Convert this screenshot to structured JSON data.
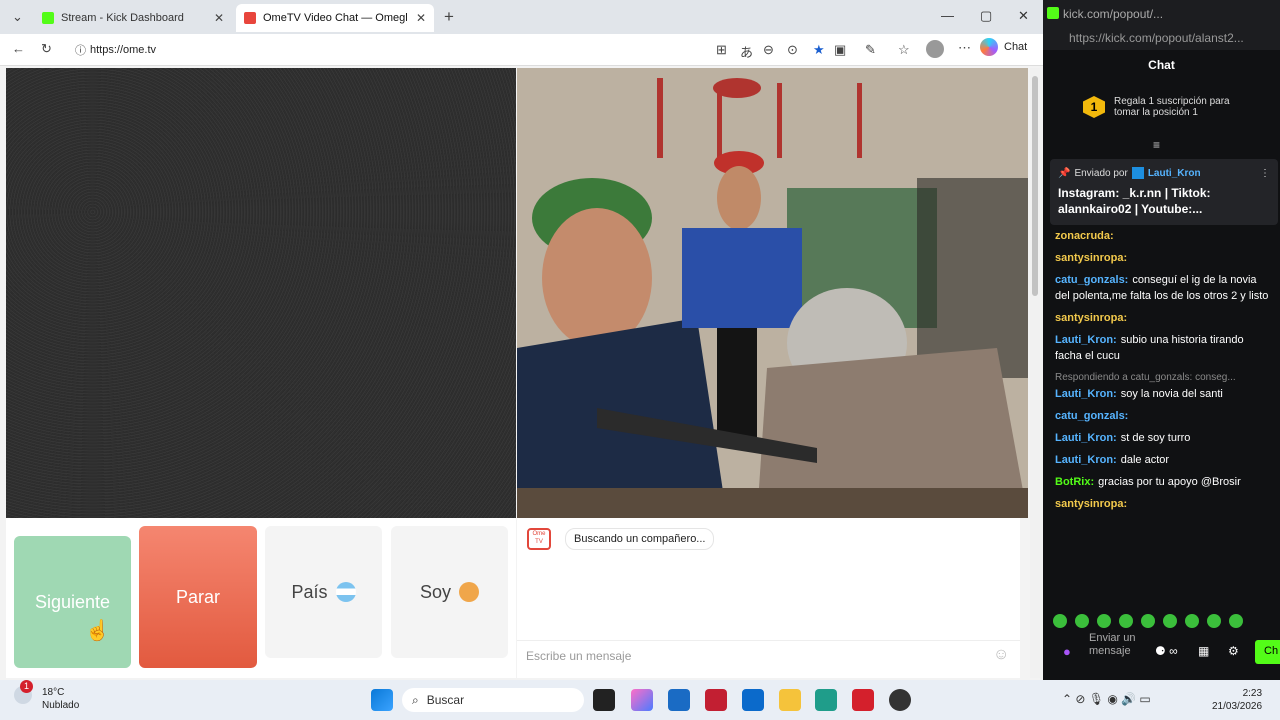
{
  "browser": {
    "tabs": [
      {
        "label": "Stream - Kick Dashboard",
        "color": "#53fc18"
      },
      {
        "label": "OmeTV Video Chat — Omegl",
        "color": "#e8453c"
      }
    ],
    "url": "https://ome.tv",
    "copilot_label": "Chat"
  },
  "controls": {
    "next": "Siguiente",
    "stop": "Parar",
    "country": "País",
    "me": "Soy"
  },
  "chat": {
    "logo_text": "Ome TV",
    "status": "Buscando un compañero...",
    "placeholder": "Escribe un mensaje"
  },
  "taskbar": {
    "weather_temp": "18°C",
    "weather_desc": "Nublado",
    "weather_badge": "1",
    "search": "Buscar",
    "time": "2:23",
    "date": "21/03/2026"
  },
  "kick": {
    "window_title": "kick.com/popout/...",
    "url": "https://kick.com/popout/alanst2...",
    "header": "Chat",
    "gift_badge": "1",
    "gift_text": "Regala 1 suscripción para tomar la posición 1",
    "pinned_prefix": "Enviado por",
    "pinned_user": "Lauti_Kron",
    "pinned_text": "Instagram: _k.r.nn | Tiktok: alannkairo02 | Youtube:...",
    "messages": [
      {
        "user": "zonacruda:",
        "text": "",
        "color": "#f2c94c"
      },
      {
        "user": "santysinropa:",
        "text": "",
        "color": "#f2c94c"
      },
      {
        "user": "catu_gonzals:",
        "text": "conseguí el ig de la novia del polenta,me falta los de los otros 2 y listo",
        "color": "#56b4ff"
      },
      {
        "user": "santysinropa:",
        "text": "",
        "color": "#f2c94c"
      },
      {
        "user": "Lauti_Kron:",
        "text": "subio una historia tirando facha el cucu",
        "color": "#56b4ff"
      },
      {
        "user": "Lauti_Kron:",
        "text": "soy la novia del santi",
        "color": "#56b4ff",
        "reply": "Respondiendo a catu_gonzals: conseg..."
      },
      {
        "user": "catu_gonzals:",
        "text": "",
        "color": "#56b4ff"
      },
      {
        "user": "Lauti_Kron:",
        "text": "st de soy turro",
        "color": "#56b4ff"
      },
      {
        "user": "Lauti_Kron:",
        "text": "dale actor",
        "color": "#56b4ff"
      },
      {
        "user": "BotRix:",
        "text": "gracias por tu apoyo @Brosir",
        "color": "#53fc18"
      },
      {
        "user": "santysinropa:",
        "text": "",
        "color": "#f2c94c"
      }
    ],
    "send_label": "Enviar un mensaje",
    "chat_btn": "Ch"
  }
}
